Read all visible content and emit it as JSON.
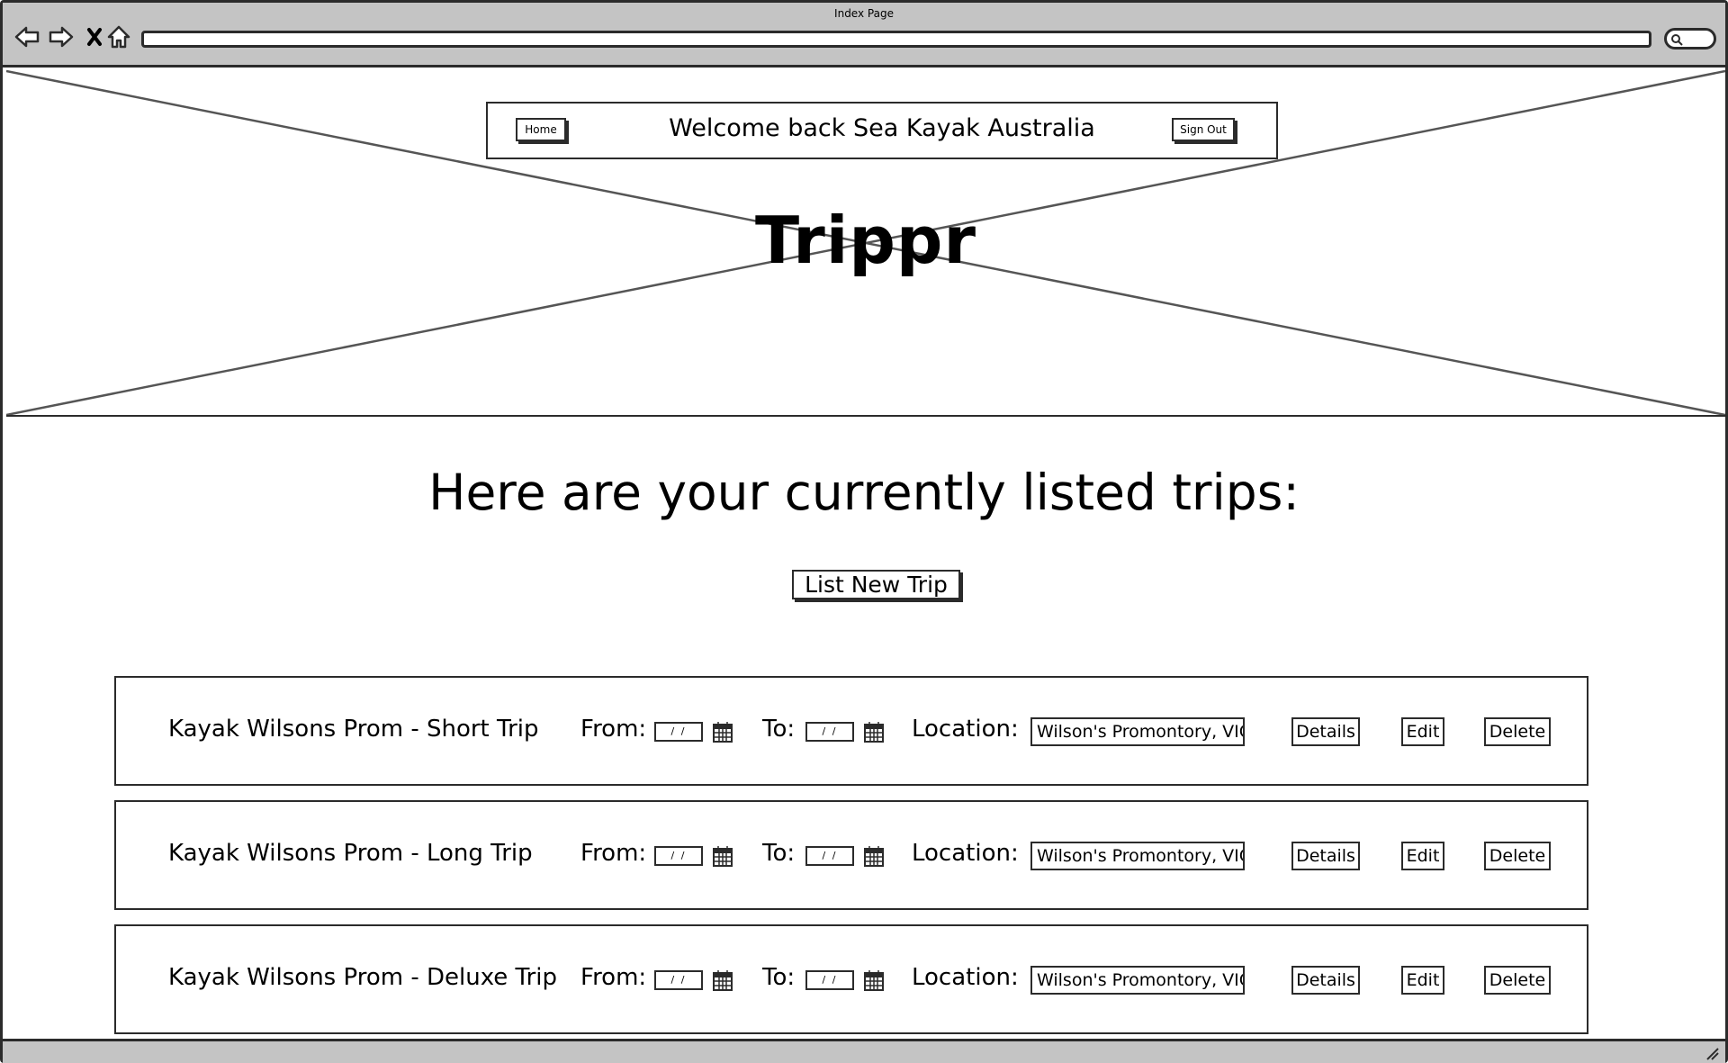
{
  "window": {
    "title": "Index Page"
  },
  "header": {
    "home_label": "Home",
    "welcome": "Welcome back Sea Kayak Australia",
    "signout_label": "Sign Out",
    "brand": "Trippr"
  },
  "main": {
    "heading": "Here are your currently listed trips:",
    "new_trip_label": "List New Trip"
  },
  "trips": [
    {
      "title": "Kayak Wilsons Prom - Short Trip",
      "from_label": "From:",
      "from_value": "/ /",
      "to_label": "To:",
      "to_value": "/ /",
      "location_label": "Location:",
      "location": "Wilson's Promontory, VIC",
      "details_label": "Details",
      "edit_label": "Edit",
      "delete_label": "Delete"
    },
    {
      "title": "Kayak Wilsons Prom - Long Trip",
      "from_label": "From:",
      "from_value": "/ /",
      "to_label": "To:",
      "to_value": "/ /",
      "location_label": "Location:",
      "location": "Wilson's Promontory, VIC",
      "details_label": "Details",
      "edit_label": "Edit",
      "delete_label": "Delete"
    },
    {
      "title": "Kayak Wilsons Prom - Deluxe Trip",
      "from_label": "From:",
      "from_value": "/ /",
      "to_label": "To:",
      "to_value": "/ /",
      "location_label": "Location:",
      "location": "Wilson's Promontory, VIC",
      "details_label": "Details",
      "edit_label": "Edit",
      "delete_label": "Delete"
    }
  ],
  "icons": {
    "back": "back-arrow-icon",
    "forward": "forward-arrow-icon",
    "stop": "close-icon",
    "home": "home-icon",
    "search": "search-icon",
    "calendar": "calendar-icon",
    "resize": "resize-grip-icon"
  },
  "colors": {
    "chrome": "#c4c4c4",
    "stroke": "#2b2b2b",
    "background": "#ffffff"
  }
}
